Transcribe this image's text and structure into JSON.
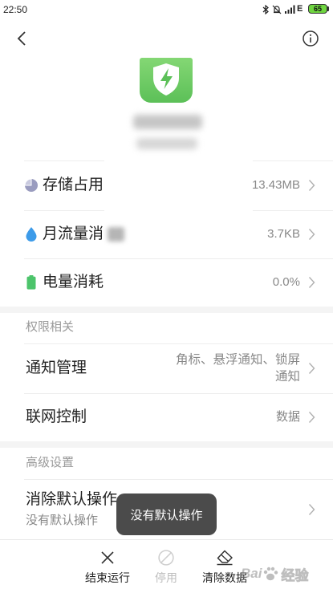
{
  "status_bar": {
    "time": "22:50",
    "icons": [
      "bluetooth-icon",
      "alarm-off-icon",
      "signal-icon"
    ],
    "network": "E",
    "battery_level": "65",
    "battery_color": "#6fd640"
  },
  "header": {
    "back_icon": "back-arrow-icon",
    "info_icon": "info-icon"
  },
  "app": {
    "icon": "shield-bolt-icon",
    "icon_color": "#5cc058"
  },
  "usage_rows": [
    {
      "label": "存储占用",
      "value": "13.43MB",
      "icon": "storage-pie-icon",
      "icon_color": "#9a9cbf"
    },
    {
      "label": "月流量消",
      "value": "3.7KB",
      "icon": "water-drop-icon",
      "icon_color": "#3d9be9"
    },
    {
      "label": "电量消耗",
      "value": "0.0%",
      "icon": "battery-icon",
      "icon_color": "#4cc46b"
    }
  ],
  "permissions": {
    "title": "权限相关",
    "rows": [
      {
        "label": "通知管理",
        "value_lines": [
          "角标、悬浮通知、锁屏",
          "通知"
        ]
      },
      {
        "label": "联网控制",
        "value": "数据"
      }
    ]
  },
  "advanced": {
    "title": "高级设置",
    "rows": [
      {
        "label": "消除默认操作",
        "subtitle": "没有默认操作"
      }
    ]
  },
  "chevron_icon": "chevron-right-icon",
  "toast": {
    "text": "没有默认操作"
  },
  "bottom_bar": {
    "actions": [
      {
        "label": "结束运行",
        "icon": "close-icon",
        "enabled": true
      },
      {
        "label": "停用",
        "icon": "disable-icon",
        "enabled": false
      },
      {
        "label": "清除数据",
        "icon": "eraser-icon",
        "enabled": true
      }
    ]
  },
  "watermark": {
    "left": "Bai",
    "right": "经验"
  }
}
